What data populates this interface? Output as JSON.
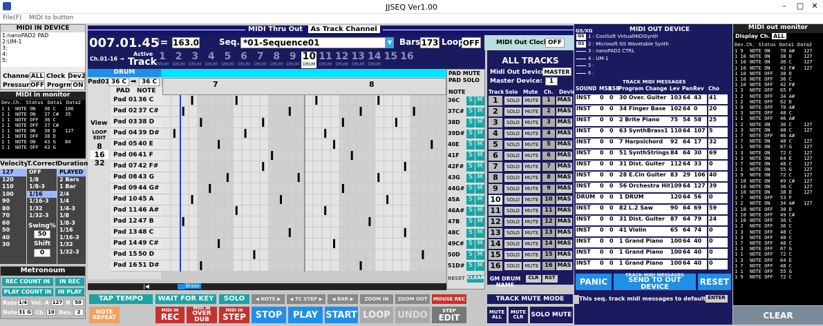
{
  "window": {
    "title": "JJSEQ  Ver1.00",
    "app_icon": "app-icon",
    "min": "–",
    "max": "□",
    "close": "✕"
  },
  "menu": {
    "file": "File(F)",
    "midi_to_button": "MIDI to button"
  },
  "midi_in": {
    "title": "MIDI IN DEVICE",
    "devices": [
      "1:nanoPAD2 PAD",
      "2:UM-1",
      "3:",
      "4:",
      "5:"
    ],
    "channel_label": "Channel",
    "channel_val": "ALL",
    "clock_label": "Clock",
    "clock_val": "Dev2",
    "pressure_label": "Pressure",
    "pressure_val": "OFF",
    "progrm_label": "Progrm",
    "progrm_val": "ON",
    "monitor_title": "MIDI in monitor",
    "monitor_cols": [
      "Dev.Ch.",
      "Status",
      "Data1",
      "Data2"
    ],
    "monitor_rows": [
      [
        "1 1",
        "NOTE ON",
        "36 C",
        "106"
      ],
      [
        "1 1",
        "NOTE ON",
        "37 C#",
        "35"
      ],
      [
        "1 1",
        "NOTE OFF",
        "36 C",
        ""
      ],
      [
        "1 1",
        "NOTE OFF",
        "37 C#",
        ""
      ],
      [
        "1 1",
        "NOTE ON",
        "38 D",
        "127"
      ],
      [
        "1 1",
        "NOTE OFF",
        "38 D",
        ""
      ],
      [
        "1 1",
        "NOTE ON",
        "43 G",
        "84"
      ],
      [
        "1 1",
        "NOTE OFF",
        "43 G",
        ""
      ]
    ]
  },
  "velocity": {
    "title": "Velocity",
    "values": [
      "127",
      "120",
      "110",
      "100",
      "90",
      "80",
      "70",
      "60",
      "50",
      "40",
      "30"
    ]
  },
  "tcorrect": {
    "title": "T.Correct",
    "values": [
      "OFF",
      "1/8",
      "1/8-3",
      "1/16",
      "1/16-3",
      "1/32",
      "1/32-3"
    ],
    "swing_label": "Swing%",
    "swing_val": "50",
    "shift_label": "Shift",
    "shift_val": "0"
  },
  "duration": {
    "title": "Duration",
    "values": [
      "PLAYED",
      "2 Bars",
      "1 Bar",
      "2/4",
      "1/4",
      "1/4-3",
      "1/8",
      "1/8-3",
      "1/16",
      "1/16-3",
      "1/32",
      "1/32-3"
    ]
  },
  "metronome": {
    "title": "Metronoum",
    "rec_count": "REC COUNT IN",
    "in_rec": "IN REC",
    "play_count": "PLAY COUNT IN",
    "in_play": "IN PLAY",
    "rate_label": "Rate",
    "rate_val": "1/4",
    "vel_label": "Vel. A",
    "vel_val": "127",
    "n_label": "N",
    "n_val": "50",
    "note_label": "Note",
    "note_val": "31 G",
    "ch_label": "Ch.",
    "ch_val": "10",
    "dev_label": "Dev.",
    "dev_val": "2"
  },
  "thru": {
    "label": "MIDI Thru Out",
    "value": "As Track Channel"
  },
  "transport": {
    "position": "007.01.45",
    "tempo_icon": "♩=",
    "tempo": "163.0",
    "seq_label": "Seq.",
    "seq_name": "*01-Sequence01",
    "bars_label": "Bars",
    "bars": "173",
    "loop_label": "Loop",
    "loop_val": "OFF",
    "clock_label": "MIDI Out Clock",
    "clock_val": "OFF"
  },
  "tracks": {
    "ch_label": "Ch.01-16 →",
    "active_label": "Active",
    "track_label": "Track",
    "numbers": [
      "1",
      "2",
      "3",
      "4",
      "5",
      "6",
      "7",
      "8",
      "9",
      "10",
      "11",
      "12",
      "13",
      "14",
      "15",
      "16"
    ],
    "sub": [
      "DRUM",
      "DRUM",
      "DRUM",
      "DRUM",
      "DRUM",
      "DRUM",
      "DRUM",
      "DRUM",
      "DRUM",
      "DRUM",
      "DRUM",
      "DRUM",
      "DRUM",
      "DRUM",
      "",
      ""
    ],
    "active": "10"
  },
  "drum": {
    "title": "DRUM",
    "pad_label": "Pad01",
    "pad_note": "36 C",
    "pad_target": "36 C",
    "col_pad": "PAD",
    "col_note": "NOTE",
    "pads": [
      [
        "Pad 01",
        "36 C"
      ],
      [
        "Pad 02",
        "37 C#"
      ],
      [
        "Pad 03",
        "38 D"
      ],
      [
        "Pad 04",
        "39 D#"
      ],
      [
        "Pad 05",
        "40 E"
      ],
      [
        "Pad 06",
        "41 F"
      ],
      [
        "Pad 07",
        "42 F#"
      ],
      [
        "Pad 08",
        "43 G"
      ],
      [
        "Pad 09",
        "44 G#"
      ],
      [
        "Pad 10",
        "45 A"
      ],
      [
        "Pad 11",
        "46 A#"
      ],
      [
        "Pad 12",
        "47 B"
      ],
      [
        "Pad 13",
        "48 C"
      ],
      [
        "Pad 14",
        "49 C#"
      ],
      [
        "Pad 15",
        "50 D"
      ],
      [
        "Pad 16",
        "51 D#"
      ]
    ],
    "view_label": "View",
    "loop_edit": "LOOP EDIT",
    "zoom_vals": [
      "8",
      "16",
      "32"
    ],
    "bar_a": "7",
    "bar_b": "8",
    "erase": "Erase"
  },
  "padmute": {
    "title": "PAD MUTE",
    "title2": "PAD SOLO",
    "note_label": "NOTE",
    "notes": [
      "36C",
      "37C#",
      "38D",
      "39D#",
      "40E",
      "41F",
      "42F#",
      "43G",
      "44G#",
      "45A",
      "46A#",
      "47B",
      "48C",
      "49C#",
      "50D",
      "51D#"
    ],
    "s": "S",
    "m": "M",
    "reset": "RESET",
    "clear": "CLEAR"
  },
  "alltracks": {
    "title": "ALL TRACKS",
    "master_label": "Midi Out Device",
    "master_val": "MASTER",
    "master_dev_label": "Master Device:",
    "master_dev_val": "1",
    "cols": [
      "Track",
      "Solo",
      "Mute",
      "Ch.",
      "Devic"
    ],
    "solo": "SOLO",
    "mute": "MUTE",
    "dev": "MAS",
    "gm_drum": "GM DRUM NAME",
    "clr": "CLR",
    "rst": "RST"
  },
  "midiout": {
    "gs_label": "GS/XG",
    "title": "MIDI OUT DEVICE",
    "devices": [
      "1 : CoolSoft VirtualMIDISynth",
      "2 : Microsoft GS Wavetable Synth",
      "3 : nanoPAD2 CTRL",
      "4 : UM-1",
      "5 :",
      "6 :"
    ],
    "gs": "GS",
    "msg_title": "TRACK MIDI MESSAGES",
    "cols": [
      "SOUND",
      "MSB",
      "LSB",
      "Program Change",
      "Lev",
      "Pan",
      "Rev",
      "Cho"
    ],
    "rows": [
      [
        "INST",
        "0",
        "0",
        "30 Over. Guiter",
        "103",
        "64",
        "43",
        "41"
      ],
      [
        "INST",
        "0",
        "0",
        "34 Finger Base",
        "102",
        "64",
        "0",
        "20"
      ],
      [
        "INST",
        "0",
        "0",
        "2  Brite Piano",
        "75",
        "54",
        "58",
        "25"
      ],
      [
        "INST",
        "0",
        "0",
        "63 SynthBrass1",
        "110",
        "64",
        "107",
        "5"
      ],
      [
        "INST",
        "0",
        "0",
        "7  Harpsichord",
        "92",
        "64",
        "17",
        "32"
      ],
      [
        "INST",
        "0",
        "0",
        "51 SynthStrings1",
        "84",
        "64",
        "30",
        "69"
      ],
      [
        "INST",
        "0",
        "0",
        "31 Dist. Guiter",
        "112",
        "64",
        "33",
        "0"
      ],
      [
        "INST",
        "0",
        "0",
        "28 E.Cin Guiter",
        "83",
        "29",
        "106",
        "40"
      ],
      [
        "INST",
        "0",
        "0",
        "56 Orchestra Hit",
        "109",
        "64",
        "127",
        "39"
      ],
      [
        "DRUM",
        "0",
        "0",
        "1  DRUM",
        "120",
        "64",
        "56",
        "0"
      ],
      [
        "INST",
        "0",
        "0",
        "82 L.2 Saw",
        "90",
        "64",
        "69",
        "59"
      ],
      [
        "INST",
        "0",
        "0",
        "31 Dist. Guiter",
        "87",
        "64",
        "79",
        "24"
      ],
      [
        "INST",
        "0",
        "0",
        "41 Violin",
        "65",
        "64",
        "74",
        "0"
      ],
      [
        "INST",
        "0",
        "0",
        "1  Grand Piano",
        "100",
        "64",
        "40",
        "0"
      ],
      [
        "INST",
        "0",
        "0",
        "1  Grand Piano",
        "100",
        "64",
        "40",
        "0"
      ],
      [
        "INST",
        "0",
        "0",
        "1  Grand Piano",
        "100",
        "64",
        "40",
        "0"
      ]
    ],
    "panic": "PANIC",
    "send_top": "TRACK MIDI MESSAGES",
    "send": "SEND TO OUT DEVICE",
    "reset": "RESET",
    "default_text": "This seq. track midi messages to default",
    "enter": "ENTER"
  },
  "outmon": {
    "title": "MIDI out monitor",
    "disp_label": "Display Ch.",
    "disp_val": "ALL",
    "cols": [
      "Dev.Ch.",
      "Status",
      "Data1",
      "Data2"
    ],
    "rows": [
      [
        "1 9",
        "NOTE ON",
        "70 A#",
        "127"
      ],
      [
        "1 10",
        "NOTE ON",
        "38 D",
        "127"
      ],
      [
        "1 10",
        "NOTE ON",
        "36 C",
        "127"
      ],
      [
        "1 10",
        "NOTE ON",
        "42 F#",
        "127"
      ],
      [
        "1 10",
        "NOTE OFF",
        "38 D",
        ""
      ],
      [
        "1 10",
        "NOTE OFF",
        "36 C",
        ""
      ],
      [
        "1 10",
        "NOTE OFF",
        "42 F#",
        ""
      ],
      [
        "1 3",
        "NOTE OFF",
        "65 F",
        ""
      ],
      [
        "1 2",
        "NOTE OFF",
        "34 A#",
        ""
      ],
      [
        "1 2",
        "NOTE OFF",
        "62 D",
        ""
      ],
      [
        "1 9",
        "NOTE OFF",
        "70 A#",
        ""
      ],
      [
        "1 3",
        "NOTE OFF",
        "48 C",
        ""
      ],
      [
        "1 1",
        "NOTE OFF",
        "46 A#",
        ""
      ],
      [
        "1 2",
        "NOTE ON",
        "36 C",
        "127"
      ],
      [
        "1 3",
        "NOTE ON",
        "48 C",
        "127"
      ],
      [
        "1 7",
        "NOTE OFF",
        "46 A#",
        ""
      ],
      [
        "1 7",
        "NOTE ON",
        "48 C",
        "127"
      ],
      [
        "1 1",
        "NOTE ON",
        "67 G",
        "127"
      ],
      [
        "1 3",
        "NOTE ON",
        "72 C",
        "127"
      ],
      [
        "1 3",
        "NOTE ON",
        "64 E",
        "127"
      ],
      [
        "1 7",
        "NOTE ON",
        "48 C",
        "127"
      ],
      [
        "1 1",
        "NOTE ON",
        "55 G",
        "127"
      ],
      [
        "1 9",
        "NOTE ON",
        "72 C",
        "127"
      ],
      [
        "1 10",
        "NOTE ON",
        "49 C#",
        "127"
      ],
      [
        "1 10",
        "NOTE ON",
        "36 C",
        "127"
      ],
      [
        "1 10",
        "NOTE ON",
        "38 D",
        "127"
      ],
      [
        "1 7",
        "NOTE OFF",
        "53 F",
        ""
      ],
      [
        "1 2",
        "NOTE ON",
        "34 A#",
        "127"
      ],
      [
        "1 10",
        "NOTE OFF",
        "38 D",
        ""
      ],
      [
        "1 10",
        "NOTE OFF",
        "49 C#",
        ""
      ],
      [
        "1 10",
        "NOTE OFF",
        "36 C",
        ""
      ],
      [
        "1 2",
        "NOTE OFF",
        "36 C",
        ""
      ],
      [
        "1 3",
        "NOTE OFF",
        "48 C",
        ""
      ],
      [
        "1 3",
        "NOTE OFF",
        "48 C",
        ""
      ],
      [
        "1 7",
        "NOTE OFF",
        "48 C",
        ""
      ],
      [
        "1 3",
        "NOTE OFF",
        "67 G",
        ""
      ],
      [
        "1 1",
        "NOTE OFF",
        "72 C",
        ""
      ],
      [
        "1 3",
        "NOTE OFF",
        "64 E",
        ""
      ],
      [
        "1 7",
        "NOTE OFF",
        "48 C",
        ""
      ],
      [
        "1 1",
        "NOTE OFF",
        "55 G",
        ""
      ],
      [
        "1 9",
        "NOTE OFF",
        "72 C",
        ""
      ]
    ],
    "clear": "CLEAR"
  },
  "bottom": {
    "tap": "TAP TEMPO",
    "note_repeat": "NOTE REPEAT",
    "wait": "WAIT FOR KEY",
    "midi_in_rec": "MIDI IN",
    "rec": "REC",
    "midi_in_od": "MIDI IN",
    "overdub": "OVER DUB",
    "solo": "SOLO",
    "midi_in_step": "MIDI IN",
    "step": "STEP",
    "note_nav": "◀ NOTE ▶",
    "tc_nav": "◀ TC STEP ▶",
    "bar_nav": "◀ BAR ▶",
    "zoom_in": "ZOOM  IN",
    "zoom_out": "ZOOM OUT",
    "mouse_rec": "MOUSE REC",
    "stop": "STOP",
    "play": "PLAY",
    "start": "START",
    "loop": "LOOP",
    "undo": "UNDO",
    "step_edit_top": "STEP",
    "step_edit": "EDIT",
    "track_mute_mode": "TRACK MUTE MODE",
    "mute_all": "MUTE ALL",
    "mute_clr": "MUTE CLR",
    "solo_mute": "SOLO MUTE",
    "scroll_left": "|◀",
    "scroll_right": "▶|"
  },
  "colors": {
    "accent": "#1f8fe8",
    "cyan": "#00e5ff",
    "navy": "#14146e",
    "teal": "#1aa3a3",
    "red": "#d23a34"
  }
}
